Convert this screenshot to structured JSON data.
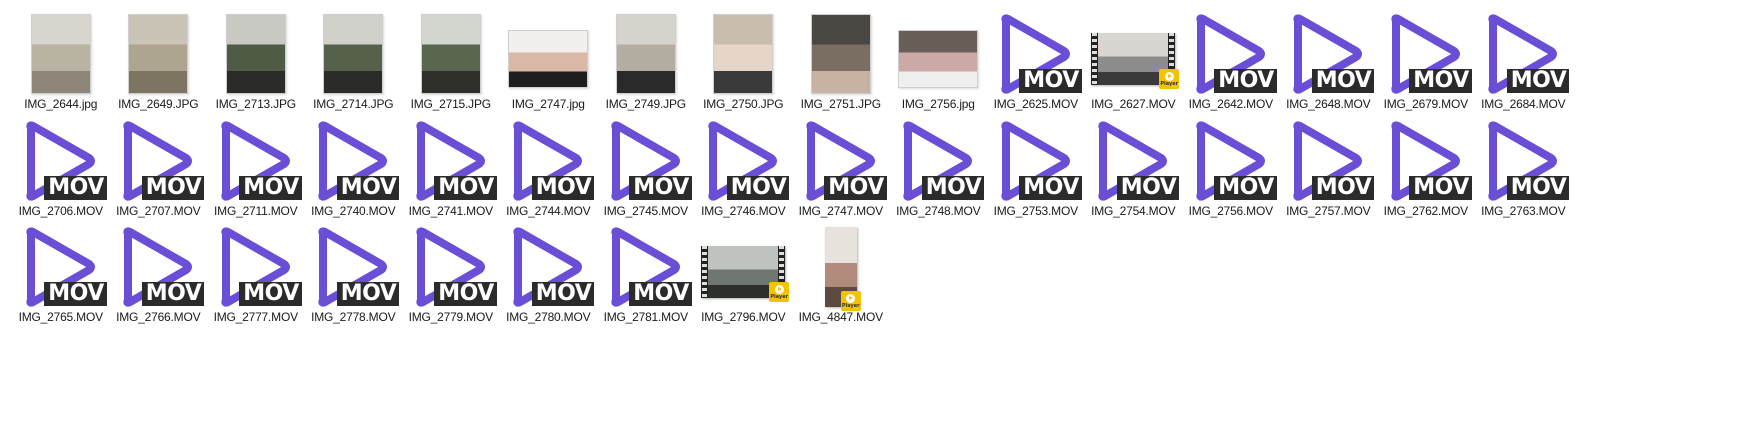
{
  "files": [
    {
      "name": "IMG_2644.jpg",
      "kind": "photo",
      "shape": "portrait",
      "palette": [
        "#d8d6cf",
        "#b9b3a4",
        "#8e8678"
      ],
      "icon": "photo-thumbnail"
    },
    {
      "name": "IMG_2649.JPG",
      "kind": "photo",
      "shape": "portrait",
      "palette": [
        "#c9c4b5",
        "#aea590",
        "#7d7462"
      ],
      "icon": "photo-thumbnail"
    },
    {
      "name": "IMG_2713.JPG",
      "kind": "photo",
      "shape": "portrait",
      "palette": [
        "#c7c9c2",
        "#4f5b45",
        "#2a2a26"
      ],
      "icon": "photo-thumbnail"
    },
    {
      "name": "IMG_2714.JPG",
      "kind": "photo",
      "shape": "portrait",
      "palette": [
        "#cfd1ca",
        "#56604b",
        "#2b2b27"
      ],
      "icon": "photo-thumbnail"
    },
    {
      "name": "IMG_2715.JPG",
      "kind": "photo",
      "shape": "portrait",
      "palette": [
        "#d3d6cf",
        "#5b6651",
        "#30302b"
      ],
      "icon": "photo-thumbnail"
    },
    {
      "name": "IMG_2747.jpg",
      "kind": "photo",
      "shape": "landscape",
      "palette": [
        "#f2efec",
        "#d9b8a8",
        "#1e1e1e"
      ],
      "icon": "photo-thumbnail"
    },
    {
      "name": "IMG_2749.JPG",
      "kind": "photo",
      "shape": "portrait",
      "palette": [
        "#d6d3cc",
        "#b3ada2",
        "#2a2a2a"
      ],
      "icon": "photo-thumbnail"
    },
    {
      "name": "IMG_2750.JPG",
      "kind": "photo",
      "shape": "portrait",
      "palette": [
        "#c9bdb0",
        "#e5d6c9",
        "#3a3a3a"
      ],
      "icon": "photo-thumbnail"
    },
    {
      "name": "IMG_2751.JPG",
      "kind": "photo",
      "shape": "portrait",
      "palette": [
        "#4a4641",
        "#7a6d62",
        "#c8b3a3"
      ],
      "icon": "photo-thumbnail"
    },
    {
      "name": "IMG_2756.jpg",
      "kind": "photo",
      "shape": "landscape",
      "palette": [
        "#6a5e58",
        "#caa9a7",
        "#efefef"
      ],
      "icon": "photo-thumbnail"
    },
    {
      "name": "IMG_2625.MOV",
      "kind": "mov",
      "icon": "mov-file-icon"
    },
    {
      "name": "IMG_2627.MOV",
      "kind": "video",
      "shape": "land",
      "palette": [
        "#d9d6d2",
        "#8c8c8c",
        "#3a3a3a"
      ],
      "icon": "video-thumbnail"
    },
    {
      "name": "IMG_2642.MOV",
      "kind": "mov",
      "icon": "mov-file-icon"
    },
    {
      "name": "IMG_2648.MOV",
      "kind": "mov",
      "icon": "mov-file-icon"
    },
    {
      "name": "IMG_2679.MOV",
      "kind": "mov",
      "icon": "mov-file-icon"
    },
    {
      "name": "IMG_2684.MOV",
      "kind": "mov",
      "icon": "mov-file-icon"
    },
    {
      "name": "IMG_2706.MOV",
      "kind": "mov",
      "icon": "mov-file-icon"
    },
    {
      "name": "IMG_2707.MOV",
      "kind": "mov",
      "icon": "mov-file-icon"
    },
    {
      "name": "IMG_2711.MOV",
      "kind": "mov",
      "icon": "mov-file-icon"
    },
    {
      "name": "IMG_2740.MOV",
      "kind": "mov",
      "icon": "mov-file-icon"
    },
    {
      "name": "IMG_2741.MOV",
      "kind": "mov",
      "icon": "mov-file-icon"
    },
    {
      "name": "IMG_2744.MOV",
      "kind": "mov",
      "icon": "mov-file-icon"
    },
    {
      "name": "IMG_2745.MOV",
      "kind": "mov",
      "icon": "mov-file-icon"
    },
    {
      "name": "IMG_2746.MOV",
      "kind": "mov",
      "icon": "mov-file-icon"
    },
    {
      "name": "IMG_2747.MOV",
      "kind": "mov",
      "icon": "mov-file-icon"
    },
    {
      "name": "IMG_2748.MOV",
      "kind": "mov",
      "icon": "mov-file-icon"
    },
    {
      "name": "IMG_2753.MOV",
      "kind": "mov",
      "icon": "mov-file-icon"
    },
    {
      "name": "IMG_2754.MOV",
      "kind": "mov",
      "icon": "mov-file-icon"
    },
    {
      "name": "IMG_2756.MOV",
      "kind": "mov",
      "icon": "mov-file-icon"
    },
    {
      "name": "IMG_2757.MOV",
      "kind": "mov",
      "icon": "mov-file-icon"
    },
    {
      "name": "IMG_2762.MOV",
      "kind": "mov",
      "icon": "mov-file-icon"
    },
    {
      "name": "IMG_2763.MOV",
      "kind": "mov",
      "icon": "mov-file-icon"
    },
    {
      "name": "IMG_2765.MOV",
      "kind": "mov",
      "icon": "mov-file-icon"
    },
    {
      "name": "IMG_2766.MOV",
      "kind": "mov",
      "icon": "mov-file-icon"
    },
    {
      "name": "IMG_2777.MOV",
      "kind": "mov",
      "icon": "mov-file-icon"
    },
    {
      "name": "IMG_2778.MOV",
      "kind": "mov",
      "icon": "mov-file-icon"
    },
    {
      "name": "IMG_2779.MOV",
      "kind": "mov",
      "icon": "mov-file-icon"
    },
    {
      "name": "IMG_2780.MOV",
      "kind": "mov",
      "icon": "mov-file-icon"
    },
    {
      "name": "IMG_2781.MOV",
      "kind": "mov",
      "icon": "mov-file-icon"
    },
    {
      "name": "IMG_2796.MOV",
      "kind": "video",
      "shape": "land",
      "palette": [
        "#bfc3c0",
        "#6f7670",
        "#2c2f2c"
      ],
      "icon": "video-thumbnail"
    },
    {
      "name": "IMG_4847.MOV",
      "kind": "video",
      "shape": "port",
      "palette": [
        "#e8e2dc",
        "#b08a7a",
        "#5b4a42"
      ],
      "icon": "video-thumbnail"
    }
  ],
  "mov_icon": {
    "tag_text": "MOV",
    "triangle_color": "#6a4fd6",
    "tag_color": "#2b2b2b"
  },
  "player_badge": {
    "text": "Player",
    "color": "#f4c300"
  }
}
